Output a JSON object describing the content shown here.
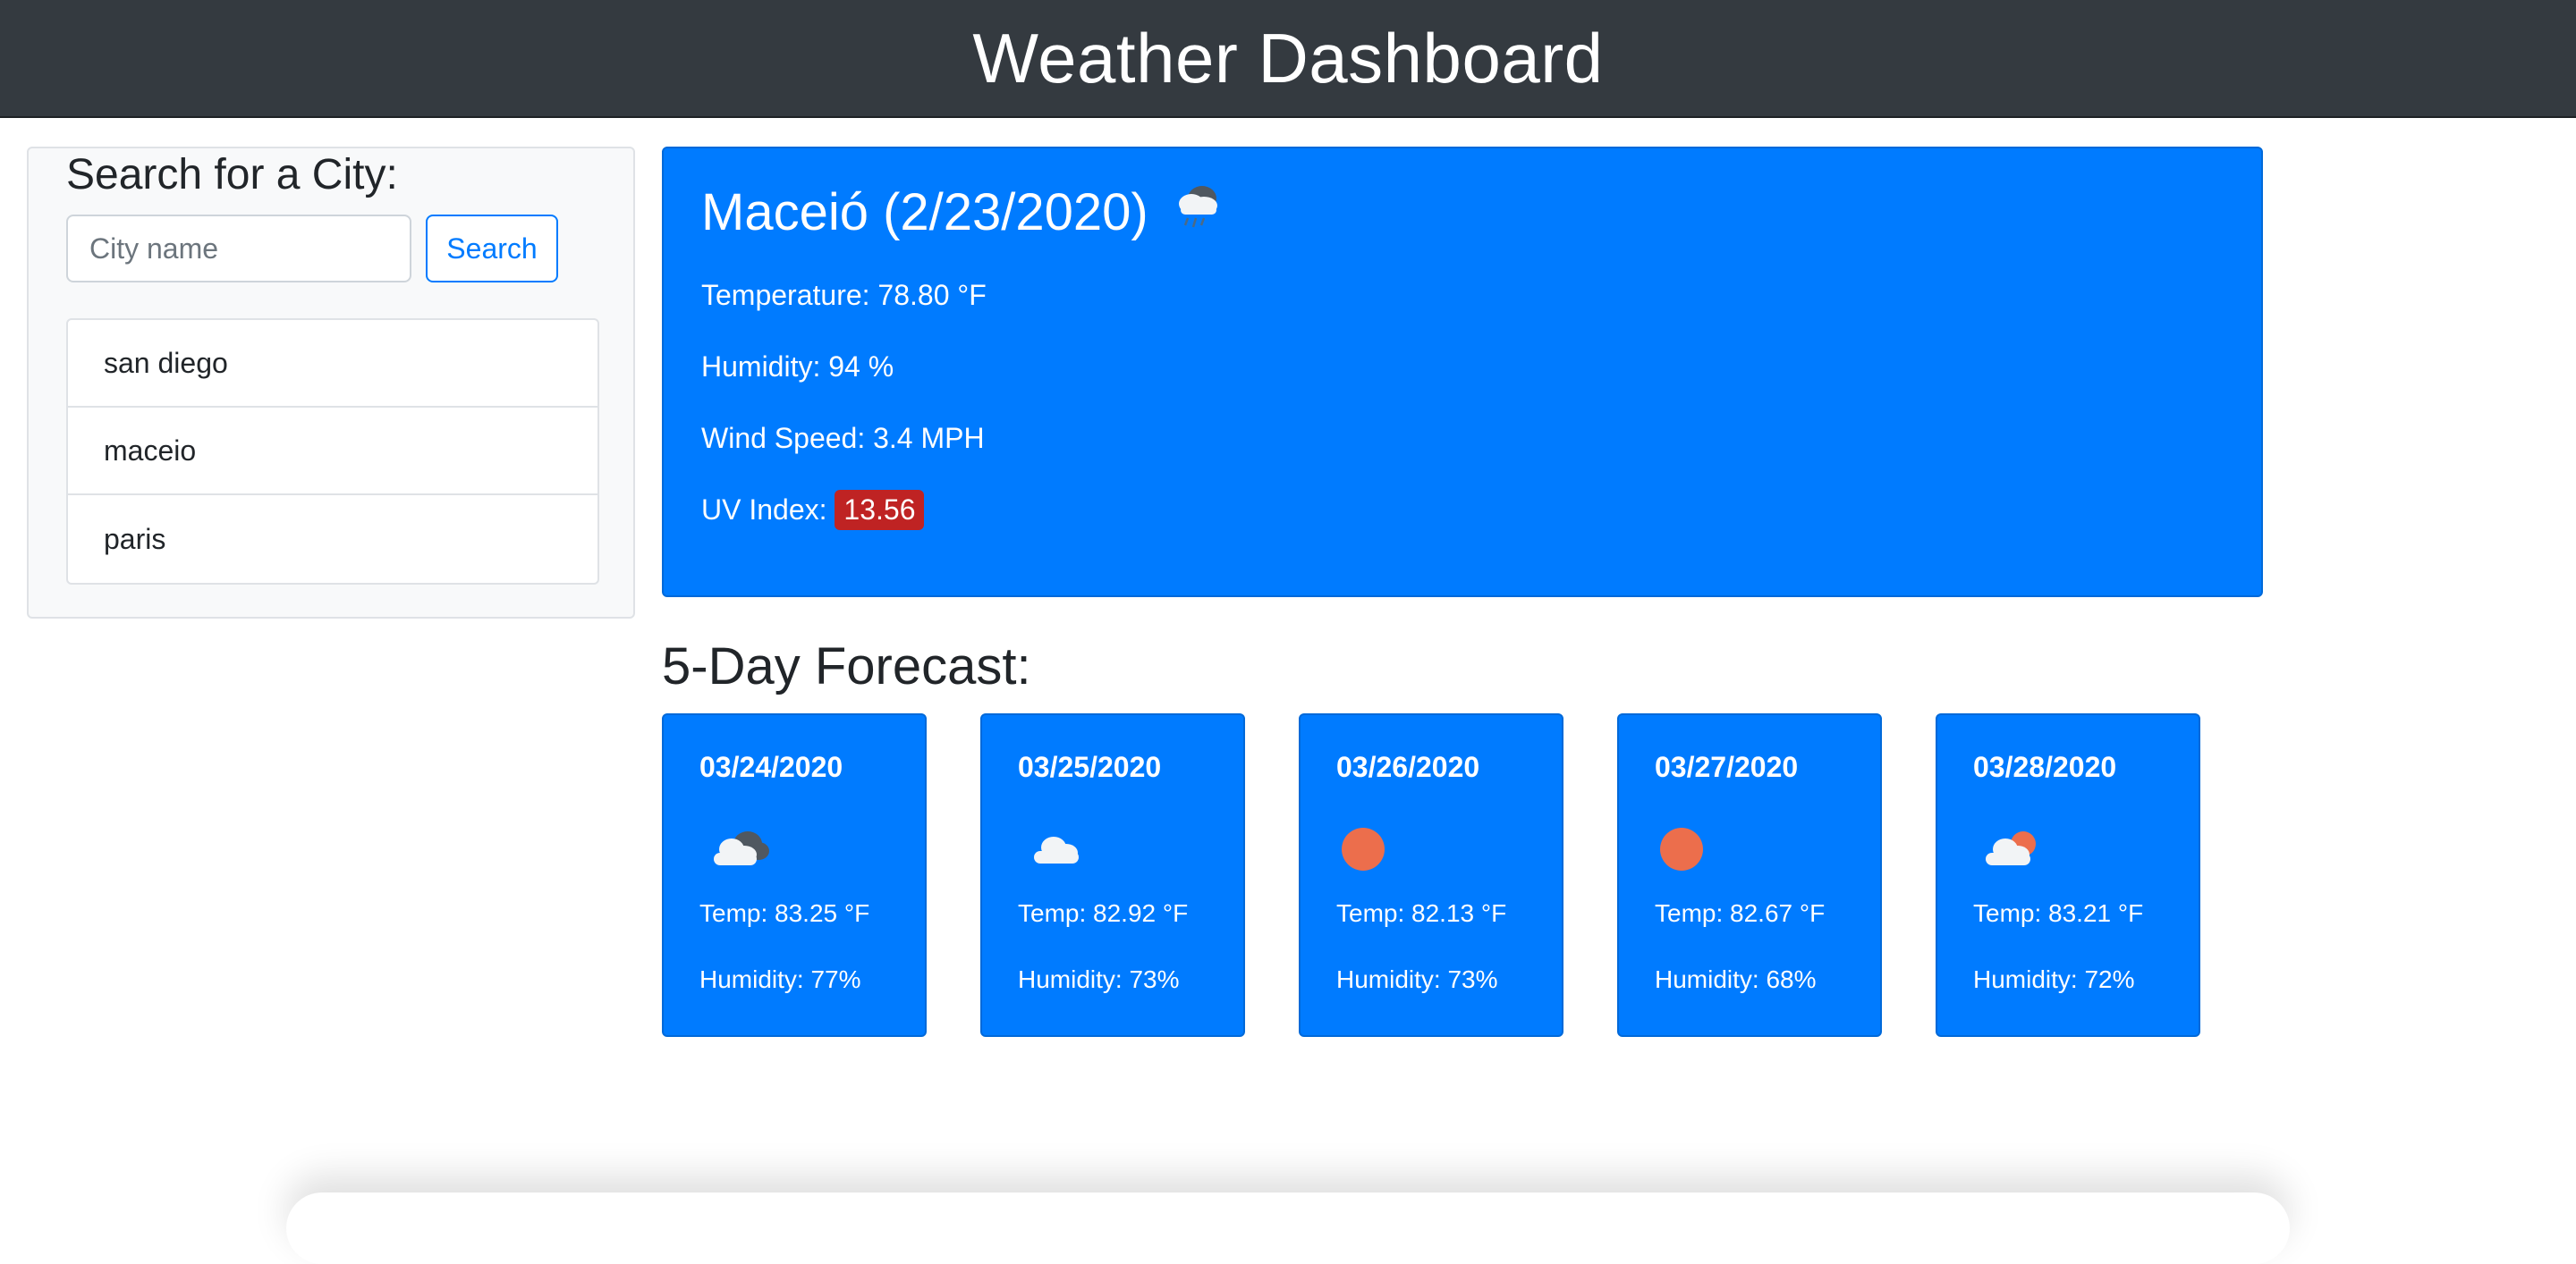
{
  "header": {
    "title": "Weather Dashboard"
  },
  "sidebar": {
    "title": "Search for a City:",
    "search_placeholder": "City name",
    "search_button": "Search",
    "cities": [
      "san diego",
      "maceio",
      "paris"
    ]
  },
  "current": {
    "title": "Maceió (2/23/2020)",
    "icon": "rain-cloud-icon",
    "temperature": "Temperature: 78.80 °F",
    "humidity": "Humidity: 94 %",
    "wind": "Wind Speed: 3.4 MPH",
    "uv_label": "UV Index:",
    "uv_value": "13.56",
    "uv_color": "#bf2323"
  },
  "forecast": {
    "title": "5-Day Forecast:",
    "days": [
      {
        "date": "03/24/2020",
        "icon": "broken-clouds-icon",
        "temp": "Temp: 83.25 °F",
        "humidity": "Humidity: 77%"
      },
      {
        "date": "03/25/2020",
        "icon": "cloud-icon",
        "temp": "Temp: 82.92 °F",
        "humidity": "Humidity: 73%"
      },
      {
        "date": "03/26/2020",
        "icon": "sun-icon",
        "temp": "Temp: 82.13 °F",
        "humidity": "Humidity: 73%"
      },
      {
        "date": "03/27/2020",
        "icon": "sun-icon",
        "temp": "Temp: 82.67 °F",
        "humidity": "Humidity: 68%"
      },
      {
        "date": "03/28/2020",
        "icon": "partly-cloudy-icon",
        "temp": "Temp: 83.21 °F",
        "humidity": "Humidity: 72%"
      }
    ]
  },
  "colors": {
    "primary": "#007bff",
    "header_bg": "#343a40",
    "sun": "#ec6e4c"
  }
}
